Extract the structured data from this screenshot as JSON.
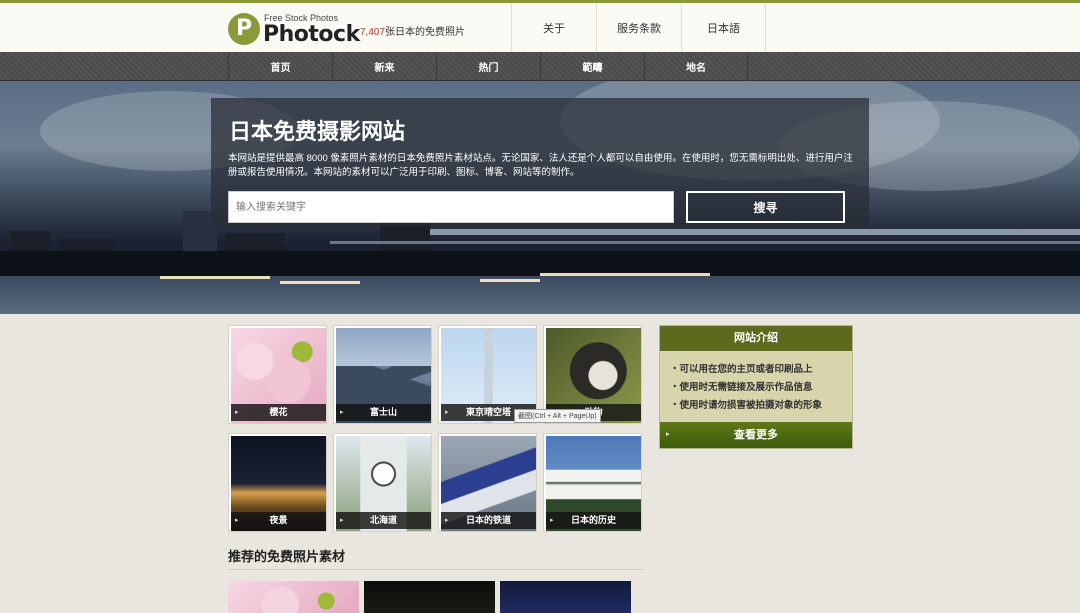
{
  "header": {
    "logo_letter": "P",
    "logo_subtitle": "Free Stock Photos",
    "logo_name": "Photock",
    "tagline_count": "7,407",
    "tagline_text": "张日本的免费照片",
    "nav": [
      {
        "label": "关于"
      },
      {
        "label": "服务条款"
      },
      {
        "label": "日本語"
      }
    ]
  },
  "main_nav": [
    {
      "label": "首页"
    },
    {
      "label": "新来"
    },
    {
      "label": "热门"
    },
    {
      "label": "範疇"
    },
    {
      "label": "地名"
    }
  ],
  "hero": {
    "title": "日本免费摄影网站",
    "description": "本网站是提供最高 8000 像素照片素材的日本免费照片素材站点。无论国家、法人还是个人都可以自由使用。在使用时，您无需标明出处、进行用户注册或报告使用情况。本网站的素材可以广泛用于印刷、图标、博客、网站等的制作。",
    "search_placeholder": "输入搜索关键字",
    "search_button": "搜寻"
  },
  "categories": [
    {
      "label": "樱花"
    },
    {
      "label": "富士山"
    },
    {
      "label": "東京晴空塔"
    },
    {
      "label": "动物"
    },
    {
      "label": "夜景"
    },
    {
      "label": "北海道"
    },
    {
      "label": "日本的铁道"
    },
    {
      "label": "日本的历史"
    }
  ],
  "tooltip": "截图(Ctrl + Alt + PageUp)",
  "sidebar": {
    "title": "网站介绍",
    "items": [
      {
        "text": "可以用在您的主页或者印刷品上"
      },
      {
        "text": "使用时无需链接及展示作品信息"
      },
      {
        "text": "使用时请勿损害被拍摄对象的形象"
      }
    ],
    "more": "查看更多"
  },
  "recommended": {
    "title": "推荐的免费照片素材"
  },
  "colors": {
    "accent": "#8a9a3a",
    "sidebar_head": "#5d6a1e",
    "sidebar_bg": "#d6d5ac",
    "tagline_num": "#b03a2e"
  }
}
